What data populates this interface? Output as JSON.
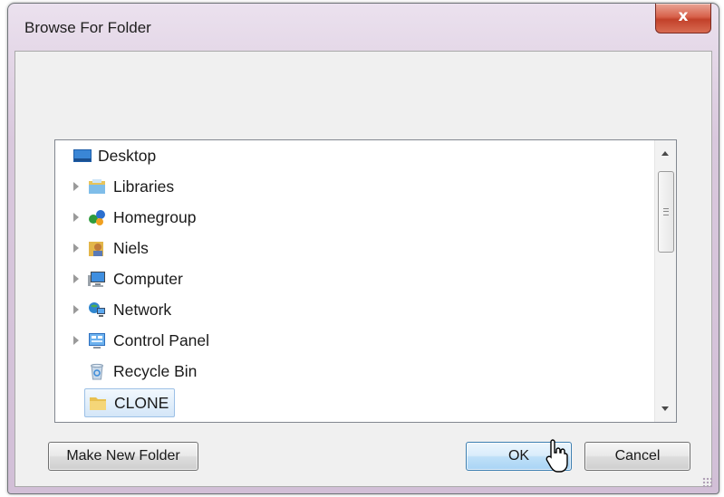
{
  "window": {
    "title": "Browse For Folder",
    "close_label": "x"
  },
  "tree": {
    "items": [
      {
        "label": "Desktop",
        "icon": "desktop-icon",
        "expandable": false
      },
      {
        "label": "Libraries",
        "icon": "libraries-icon",
        "expandable": true
      },
      {
        "label": "Homegroup",
        "icon": "homegroup-icon",
        "expandable": true
      },
      {
        "label": "Niels",
        "icon": "user-folder-icon",
        "expandable": true
      },
      {
        "label": "Computer",
        "icon": "computer-icon",
        "expandable": true
      },
      {
        "label": "Network",
        "icon": "network-icon",
        "expandable": true
      },
      {
        "label": "Control Panel",
        "icon": "control-panel-icon",
        "expandable": true
      },
      {
        "label": "Recycle Bin",
        "icon": "recycle-bin-icon",
        "expandable": false
      },
      {
        "label": "CLONE",
        "icon": "folder-icon",
        "expandable": false,
        "selected": true
      }
    ]
  },
  "buttons": {
    "make_new_folder": "Make New Folder",
    "ok": "OK",
    "cancel": "Cancel"
  },
  "colors": {
    "accent": "#3c7fb1",
    "selection": "#d4e6f8",
    "close": "#c2412a"
  }
}
